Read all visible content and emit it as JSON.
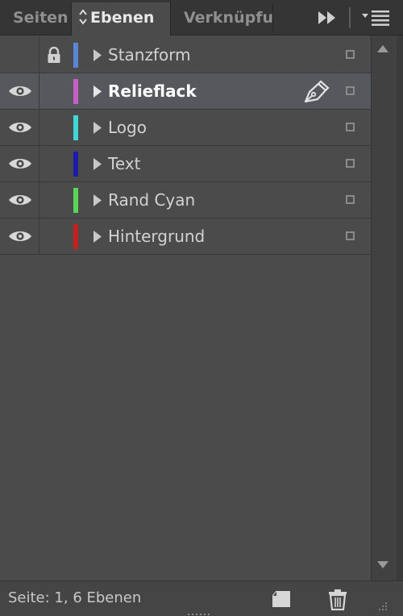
{
  "tabs": [
    {
      "label": "Seiten",
      "active": false
    },
    {
      "label": "Ebenen",
      "active": true
    },
    {
      "label": "Verknüpfu",
      "active": false
    }
  ],
  "toolbar": {
    "expand_icon": "fast-forward-icon",
    "menu_icon": "panel-menu-icon"
  },
  "layers": [
    {
      "name": "Stanzform",
      "visible": false,
      "locked": true,
      "color": "#5b86d6",
      "selected": false
    },
    {
      "name": "Relieflack",
      "visible": true,
      "locked": false,
      "color": "#c65ec6",
      "selected": true
    },
    {
      "name": "Logo",
      "visible": true,
      "locked": false,
      "color": "#3fd6d6",
      "selected": false
    },
    {
      "name": "Text",
      "visible": true,
      "locked": false,
      "color": "#1c1ca8",
      "selected": false
    },
    {
      "name": "Rand Cyan",
      "visible": true,
      "locked": false,
      "color": "#57d657",
      "selected": false
    },
    {
      "name": "Hintergrund",
      "visible": true,
      "locked": false,
      "color": "#c42020",
      "selected": false
    }
  ],
  "footer": {
    "status": "Seite: 1, 6 Ebenen"
  },
  "colors": {
    "panel_bg": "#4b4b4b",
    "tabbar_bg": "#353535",
    "selected_row": "#56585d"
  }
}
